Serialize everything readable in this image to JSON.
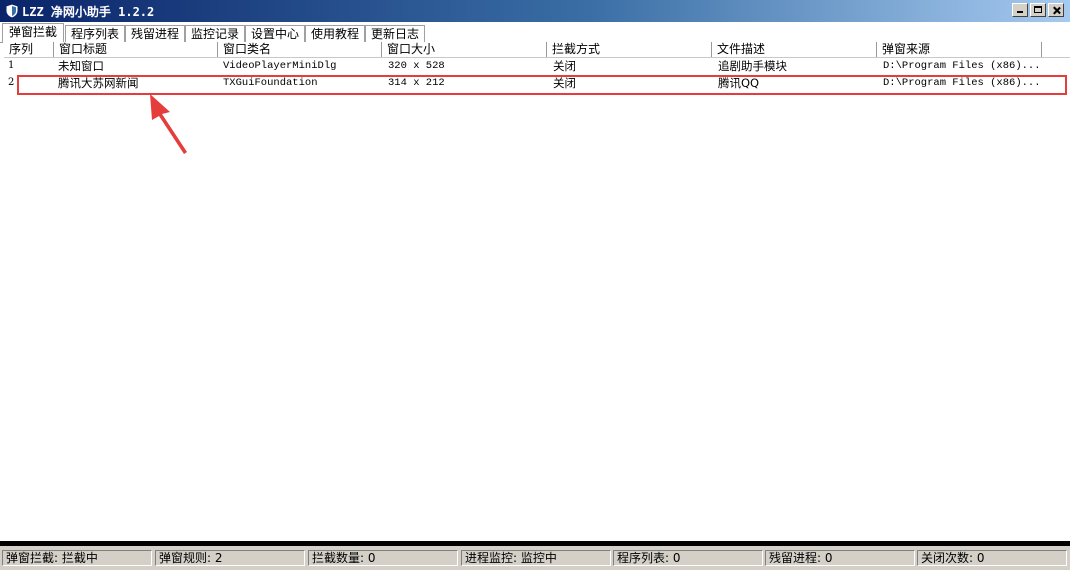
{
  "window": {
    "title": "LZZ 净网小助手 1.2.2",
    "accent": "#0a246a",
    "highlight_color": "#e53c3c"
  },
  "tabs": [
    {
      "label": "弹窗拦截",
      "active": true
    },
    {
      "label": "程序列表",
      "active": false
    },
    {
      "label": "残留进程",
      "active": false
    },
    {
      "label": "监控记录",
      "active": false
    },
    {
      "label": "设置中心",
      "active": false
    },
    {
      "label": "使用教程",
      "active": false
    },
    {
      "label": "更新日志",
      "active": false
    }
  ],
  "table": {
    "columns": [
      "序列",
      "窗口标题",
      "窗口类名",
      "窗口大小",
      "拦截方式",
      "文件描述",
      "弹窗来源"
    ],
    "rows": [
      [
        "1",
        "未知窗口",
        "VideoPlayerMiniDlg",
        "320 x 528",
        "关闭",
        "追剧助手模块",
        "D:\\Program Files (x86)..."
      ],
      [
        "2",
        "腾讯大苏网新闻",
        "TXGuiFoundation",
        "314 x 212",
        "关闭",
        "腾讯QQ",
        "D:\\Program Files (x86)..."
      ]
    ]
  },
  "status": [
    "弹窗拦截: 拦截中",
    "弹窗规则: 2",
    "拦截数量: 0",
    "进程监控: 监控中",
    "程序列表: 0",
    "残留进程: 0",
    "关闭次数: 0"
  ],
  "icons": {
    "app": "shield-icon",
    "annotation": "arrow-icon"
  }
}
